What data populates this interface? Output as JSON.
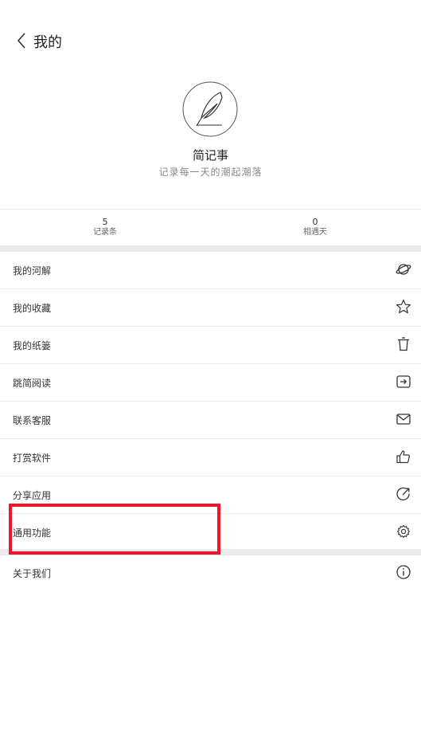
{
  "header": {
    "title": "我的"
  },
  "profile": {
    "app_name": "简记事",
    "slogan": "记录每一天的潮起潮落"
  },
  "stats": [
    {
      "value": "5",
      "label": "记录条"
    },
    {
      "value": "0",
      "label": "相遇天"
    }
  ],
  "menu": [
    {
      "label": "我的河解",
      "icon": "planet-icon"
    },
    {
      "label": "我的收藏",
      "icon": "star-icon"
    },
    {
      "label": "我的纸篓",
      "icon": "trash-icon"
    },
    {
      "label": "跳简阅读",
      "icon": "enter-icon"
    },
    {
      "label": "联系客服",
      "icon": "mail-icon"
    },
    {
      "label": "打赏软件",
      "icon": "thumbs-up-icon"
    },
    {
      "label": "分享应用",
      "icon": "share-icon"
    },
    {
      "label": "通用功能",
      "icon": "gear-icon"
    }
  ],
  "about": {
    "label": "关于我们",
    "icon": "info-icon"
  },
  "colors": {
    "highlight": "#e8192c",
    "divider": "#ebebeb"
  }
}
